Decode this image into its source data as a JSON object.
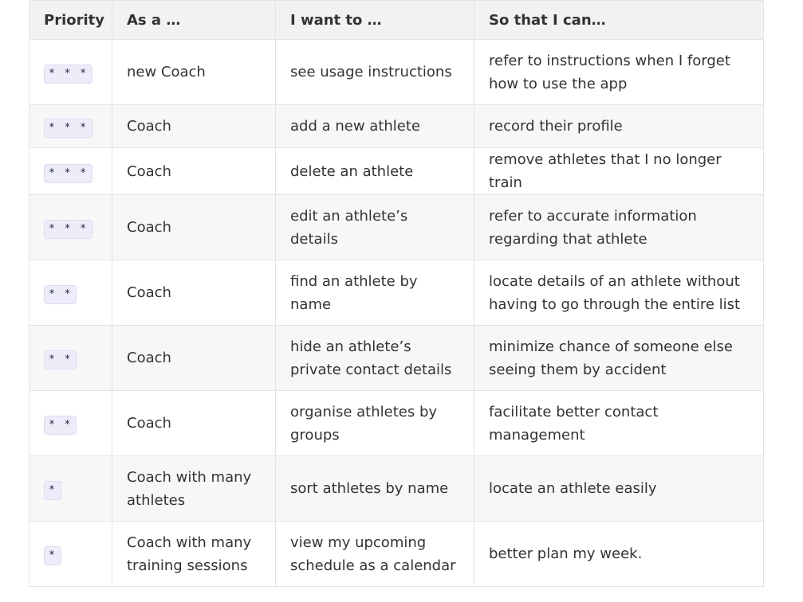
{
  "headers": [
    "Priority",
    "As a …",
    "I want to …",
    "So that I can…"
  ],
  "rows": [
    {
      "priority": "* * *",
      "as_a": "new Coach",
      "want": "see usage instructions",
      "so_that": "refer to instructions when I forget how to use the app"
    },
    {
      "priority": "* * *",
      "as_a": "Coach",
      "want": "add a new athlete",
      "so_that": "record their profile"
    },
    {
      "priority": "* * *",
      "as_a": "Coach",
      "want": "delete an athlete",
      "so_that": "remove athletes that I no longer train"
    },
    {
      "priority": "* * *",
      "as_a": "Coach",
      "want": "edit an athlete’s details",
      "so_that": "refer to accurate information regarding that athlete"
    },
    {
      "priority": "* *",
      "as_a": "Coach",
      "want": "find an athlete by name",
      "so_that": "locate details of an athlete without having to go through the entire list"
    },
    {
      "priority": "* *",
      "as_a": "Coach",
      "want": "hide an athlete’s private contact details",
      "so_that": "minimize chance of someone else seeing them by accident"
    },
    {
      "priority": "* *",
      "as_a": "Coach",
      "want": "organise athletes by groups",
      "so_that": "facilitate better contact management"
    },
    {
      "priority": "*",
      "as_a": "Coach with many athletes",
      "want": "sort athletes by name",
      "so_that": "locate an athlete easily"
    },
    {
      "priority": "*",
      "as_a": "Coach with many training sessions",
      "want": "view my upcoming schedule as a calendar",
      "so_that": "better plan my week."
    }
  ]
}
